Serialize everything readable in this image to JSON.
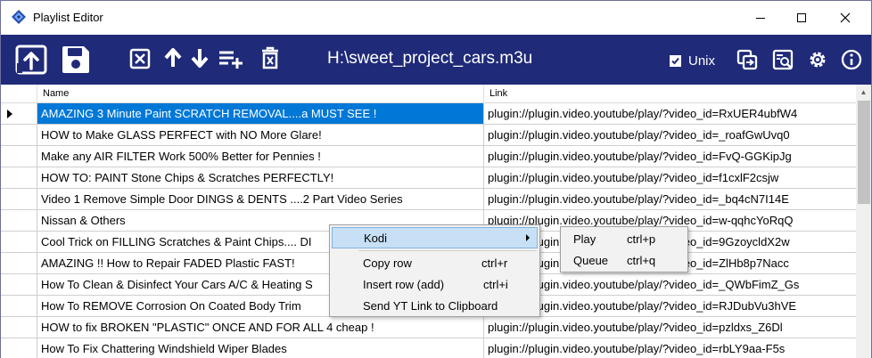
{
  "window": {
    "title": "Playlist Editor",
    "minimize_icon": "minimize-icon",
    "maximize_icon": "maximize-icon",
    "close_icon": "close-icon"
  },
  "toolbar": {
    "path": "H:\\sweet_project_cars.m3u",
    "unix_label": "Unix",
    "unix_checked": true,
    "icons": [
      "open-icon",
      "save-icon",
      "delete-icon",
      "move-up-icon",
      "move-down-icon",
      "add-to-list-icon",
      "trash-icon",
      "copy-icon",
      "find-icon",
      "settings-icon",
      "info-icon"
    ]
  },
  "grid": {
    "columns": [
      "Name",
      "Link"
    ],
    "rows": [
      {
        "name": "AMAZING 3 Minute Paint SCRATCH REMOVAL....a MUST SEE !",
        "link": "plugin://plugin.video.youtube/play/?video_id=RxUER4ubfW4"
      },
      {
        "name": "HOW to Make GLASS PERFECT with NO More Glare!",
        "link": "plugin://plugin.video.youtube/play/?video_id=_roafGwUvq0"
      },
      {
        "name": "Make any AIR FILTER Work 500% Better for Pennies !",
        "link": "plugin://plugin.video.youtube/play/?video_id=FvQ-GGKipJg"
      },
      {
        "name": "HOW TO: PAINT Stone Chips & Scratches PERFECTLY!",
        "link": "plugin://plugin.video.youtube/play/?video_id=f1cxlF2csjw"
      },
      {
        "name": "Video  1 Remove Simple Door DINGS & DENTS ....2 Part Video Series",
        "link": "plugin://plugin.video.youtube/play/?video_id=_bq4cN7I14E"
      },
      {
        "name": "Nissan & Others",
        "link": "plugin://plugin.video.youtube/play/?video_id=w-qqhcYoRqQ"
      },
      {
        "name": "Cool Trick on FILLING Scratches & Paint Chips.... DI",
        "link": "plugin://plugin.video.youtube/play/?video_id=9GzoycldX2w"
      },
      {
        "name": "AMAZING !! How to Repair FADED Plastic FAST!",
        "link": "plugin://plugin.video.youtube/play/?video_id=ZlHb8p7Nacc"
      },
      {
        "name": "How To Clean & Disinfect Your Cars A/C & Heating S",
        "link": "plugin://plugin.video.youtube/play/?video_id=_QWbFimZ_Gs"
      },
      {
        "name": "How To REMOVE Corrosion On Coated Body Trim",
        "link": "plugin://plugin.video.youtube/play/?video_id=RJDubVu3hVE"
      },
      {
        "name": "HOW to fix BROKEN \"PLASTIC\" ONCE AND FOR ALL 4 cheap !",
        "link": "plugin://plugin.video.youtube/play/?video_id=pzldxs_Z6Dl"
      },
      {
        "name": "How To Fix Chattering Windshield Wiper Blades",
        "link": "plugin://plugin.video.youtube/play/?video_id=rbLY9aa-F5s"
      }
    ]
  },
  "context_menu": {
    "kodi": "Kodi",
    "copy_row": "Copy row",
    "copy_row_shortcut": "ctrl+r",
    "insert_row": "Insert row (add)",
    "insert_row_shortcut": "ctrl+i",
    "send_yt": "Send YT Link to Clipboard"
  },
  "kodi_submenu": {
    "play": "Play",
    "play_shortcut": "ctrl+p",
    "queue": "Queue",
    "queue_shortcut": "ctrl+q"
  },
  "colors": {
    "toolbar_bg": "#1f2a78",
    "selection": "#0078d7",
    "menu_hover": "#c8e0f5"
  }
}
